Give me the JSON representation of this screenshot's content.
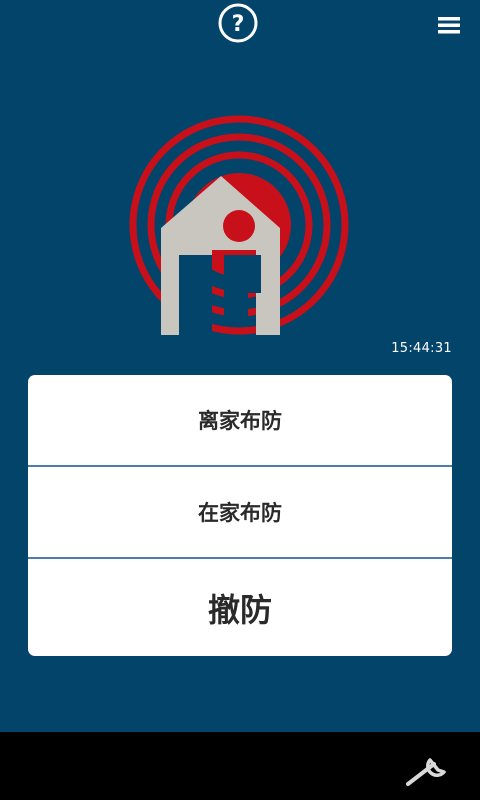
{
  "header": {
    "help_icon": "question-circle-icon",
    "menu_icon": "hamburger-menu-icon"
  },
  "status": {
    "time": "15:44:31",
    "graphic": "house-alarm-signal-icon",
    "colors": {
      "background": "#02446a",
      "signal": "#c8101a",
      "house": "#c9c6c0"
    }
  },
  "modes": {
    "away_arm": "离家布防",
    "home_arm": "在家布防",
    "disarm": "撤防"
  },
  "footer": {
    "settings_icon": "wrench-icon"
  }
}
